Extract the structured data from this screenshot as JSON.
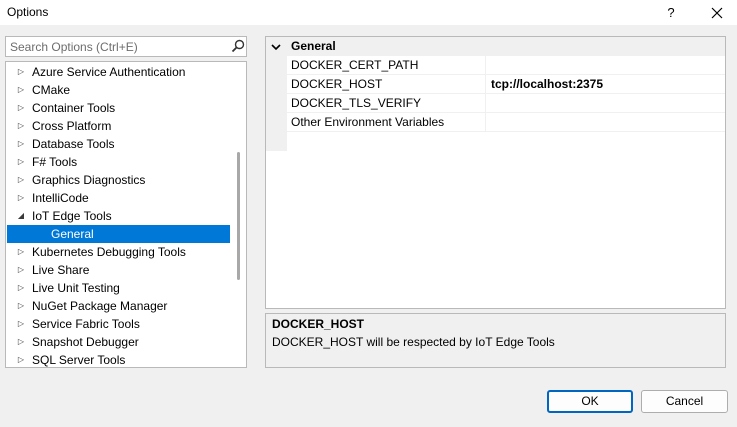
{
  "window": {
    "title": "Options",
    "help_label": "?"
  },
  "search": {
    "value": "",
    "placeholder": "Search Options (Ctrl+E)",
    "icon": "search-icon"
  },
  "tree": {
    "items": [
      {
        "label": "Azure Service Authentication",
        "arrow": "▷"
      },
      {
        "label": "CMake",
        "arrow": "▷"
      },
      {
        "label": "Container Tools",
        "arrow": "▷"
      },
      {
        "label": "Cross Platform",
        "arrow": "▷"
      },
      {
        "label": "Database Tools",
        "arrow": "▷"
      },
      {
        "label": "F# Tools",
        "arrow": "▷"
      },
      {
        "label": "Graphics Diagnostics",
        "arrow": "▷"
      },
      {
        "label": "IntelliCode",
        "arrow": "▷"
      },
      {
        "label": "IoT Edge Tools",
        "arrow": "◢"
      },
      {
        "label": "General",
        "arrow": ""
      },
      {
        "label": "Kubernetes Debugging Tools",
        "arrow": "▷"
      },
      {
        "label": "Live Share",
        "arrow": "▷"
      },
      {
        "label": "Live Unit Testing",
        "arrow": "▷"
      },
      {
        "label": "NuGet Package Manager",
        "arrow": "▷"
      },
      {
        "label": "Service Fabric Tools",
        "arrow": "▷"
      },
      {
        "label": "Snapshot Debugger",
        "arrow": "▷"
      },
      {
        "label": "SQL Server Tools",
        "arrow": "▷"
      }
    ],
    "selected": "General"
  },
  "grid": {
    "category": "General",
    "properties": [
      {
        "name": "DOCKER_CERT_PATH",
        "value": ""
      },
      {
        "name": "DOCKER_HOST",
        "value": "tcp://localhost:2375"
      },
      {
        "name": "DOCKER_TLS_VERIFY",
        "value": ""
      },
      {
        "name": "Other Environment Variables",
        "value": ""
      }
    ]
  },
  "description": {
    "title": "DOCKER_HOST",
    "text": "DOCKER_HOST will be respected by IoT Edge Tools"
  },
  "buttons": {
    "ok": "OK",
    "cancel": "Cancel"
  },
  "colors": {
    "selection": "#0078d7",
    "default_button_border": "#0067c0"
  }
}
